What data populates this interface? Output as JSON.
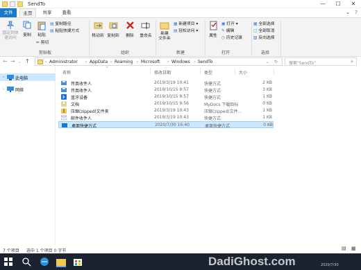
{
  "window": {
    "title": "SendTo"
  },
  "tabs": [
    "文件",
    "主页",
    "共享",
    "查看"
  ],
  "ribbon": {
    "pin_label": "固定到快\n速访问",
    "copy_label": "复制",
    "paste_label": "粘贴",
    "copy_path": "复制路径",
    "paste_shortcut": "粘贴快捷方式",
    "cut": "剪切",
    "clipboard_group": "剪贴板",
    "move_to": "移动到",
    "copy_to": "复制到",
    "delete": "删除",
    "rename": "重命名",
    "organize_group": "组织",
    "new_folder": "新建\n文件夹",
    "new_item": "新建项目",
    "easy_access": "轻松访问",
    "new_group": "新建",
    "properties": "属性",
    "open": "打开",
    "edit": "编辑",
    "history": "历史记录",
    "open_group": "打开",
    "select_all": "全部选择",
    "select_none": "全部取消",
    "invert": "反向选择",
    "select_group": "选择"
  },
  "address": {
    "crumbs": [
      "Administrator",
      "AppData",
      "Roaming",
      "Microsoft",
      "Windows",
      "SendTo"
    ],
    "search_placeholder": "搜索\"SendTo\""
  },
  "navpane": {
    "items": [
      "此电脑",
      "网络"
    ]
  },
  "columns": {
    "name": "名称",
    "date": "修改日期",
    "type": "类型",
    "size": "大小"
  },
  "files": [
    {
      "name": "传真收件人",
      "date": "2019/3/19 10:41",
      "type": "快捷方式",
      "size": "2 KB"
    },
    {
      "name": "传真收件人",
      "date": "2019/10/15 9:57",
      "type": "快捷方式",
      "size": "3 KB"
    },
    {
      "name": "蓝牙设备",
      "date": "2019/10/15 9:57",
      "type": "快捷方式",
      "size": "1 KB"
    },
    {
      "name": "文档",
      "date": "2019/10/15 9:56",
      "type": "MyDocs 下载目标",
      "size": "0 KB"
    },
    {
      "name": "压缩(zipped)文件夹",
      "date": "2019/3/19 10:43",
      "type": "压缩(zipped)文件...",
      "size": "1 KB"
    },
    {
      "name": "邮件收件人",
      "date": "2019/3/19 10:43",
      "type": "快捷方式",
      "size": "1 KB"
    },
    {
      "name": "桌面快捷方式",
      "date": "2020/7/30 16:40",
      "type": "桌面快捷方式",
      "size": "0 KB"
    }
  ],
  "status": {
    "count": "7 个项目",
    "selected": "选中 1 个项目 0 字节"
  },
  "taskbar": {
    "watermark": "DadiGhost.com",
    "clock": "2020/7/30"
  },
  "colors": {
    "accent": "#1979ca",
    "selection": "#cce8ff",
    "taskbar": "#1b2330"
  }
}
